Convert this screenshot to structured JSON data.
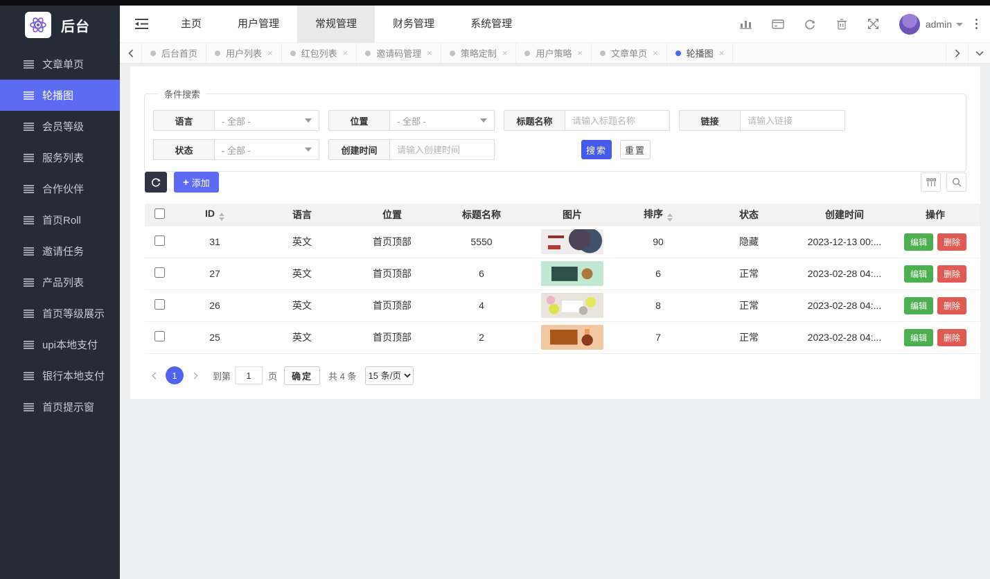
{
  "colors": {
    "sidebar_bg": "#262b38",
    "accent_indigo": "#5c6bf2",
    "search_button_blue": "#4659f0",
    "pager_circle_blue": "#5161f0",
    "active_tab_dot_blue": "#4a69f5",
    "edit_green": "#4cb050",
    "delete_red": "#e15953"
  },
  "sidebar": {
    "logo_text": "后台",
    "items": [
      {
        "label": "文章单页",
        "active": false
      },
      {
        "label": "轮播图",
        "active": true
      },
      {
        "label": "会员等级",
        "active": false
      },
      {
        "label": "服务列表",
        "active": false
      },
      {
        "label": "合作伙伴",
        "active": false
      },
      {
        "label": "首页Roll",
        "active": false
      },
      {
        "label": "邀请任务",
        "active": false
      },
      {
        "label": "产品列表",
        "active": false
      },
      {
        "label": "首页等级展示",
        "active": false
      },
      {
        "label": "upi本地支付",
        "active": false
      },
      {
        "label": "银行本地支付",
        "active": false
      },
      {
        "label": "首页提示窗",
        "active": false
      }
    ]
  },
  "topnav": {
    "items": [
      {
        "label": "主页",
        "active": false
      },
      {
        "label": "用户管理",
        "active": false
      },
      {
        "label": "常规管理",
        "active": true
      },
      {
        "label": "财务管理",
        "active": false
      },
      {
        "label": "系统管理",
        "active": false
      }
    ]
  },
  "header": {
    "user_name": "admin",
    "icons": [
      "chart-icon",
      "card-icon",
      "refresh-icon",
      "trash-icon",
      "fullscreen-icon"
    ]
  },
  "tabs": {
    "close_glyph": "×",
    "items": [
      {
        "label": "后台首页",
        "closable": false,
        "active": false
      },
      {
        "label": "用户列表",
        "closable": true,
        "active": false
      },
      {
        "label": "红包列表",
        "closable": true,
        "active": false
      },
      {
        "label": "邀请码管理",
        "closable": true,
        "active": false
      },
      {
        "label": "策略定制",
        "closable": true,
        "active": false
      },
      {
        "label": "用户策略",
        "closable": true,
        "active": false
      },
      {
        "label": "文章单页",
        "closable": true,
        "active": false
      },
      {
        "label": "轮播图",
        "closable": true,
        "active": true
      }
    ]
  },
  "search": {
    "legend": "条件搜索",
    "fields": [
      {
        "label": "语言",
        "type": "select",
        "value": "- 全部 -",
        "row": 1
      },
      {
        "label": "位置",
        "type": "select",
        "value": "- 全部 -",
        "row": 1
      },
      {
        "label": "标题名称",
        "type": "text",
        "placeholder": "请输入标题名称",
        "row": 1
      },
      {
        "label": "链接",
        "type": "text",
        "placeholder": "请输入链接",
        "row": 1
      },
      {
        "label": "状态",
        "type": "select",
        "value": "- 全部 -",
        "row": 2
      },
      {
        "label": "创建时间",
        "type": "text",
        "placeholder": "请输入创建时间",
        "row": 2
      }
    ],
    "search_label": "搜索",
    "reset_label": "重置"
  },
  "toolbar": {
    "add_plus": "+",
    "add_label": "添加"
  },
  "table": {
    "columns": [
      {
        "label": "ID",
        "sortable": true
      },
      {
        "label": "语言",
        "sortable": false
      },
      {
        "label": "位置",
        "sortable": false
      },
      {
        "label": "标题名称",
        "sortable": false
      },
      {
        "label": "图片",
        "sortable": false
      },
      {
        "label": "排序",
        "sortable": true
      },
      {
        "label": "状态",
        "sortable": false
      },
      {
        "label": "创建时间",
        "sortable": false
      },
      {
        "label": "操作",
        "sortable": false
      }
    ],
    "edit_label": "编辑",
    "delete_label": "删除",
    "rows": [
      {
        "id": "31",
        "language": "英文",
        "position": "首页顶部",
        "title": "5550",
        "thumb": "thumb-1",
        "sort": "90",
        "status": "隐藏",
        "created": "2023-12-13 00:..."
      },
      {
        "id": "27",
        "language": "英文",
        "position": "首页顶部",
        "title": "6",
        "thumb": "thumb-2",
        "sort": "6",
        "status": "正常",
        "created": "2023-02-28 04:..."
      },
      {
        "id": "26",
        "language": "英文",
        "position": "首页顶部",
        "title": "4",
        "thumb": "thumb-3",
        "sort": "8",
        "status": "正常",
        "created": "2023-02-28 04:..."
      },
      {
        "id": "25",
        "language": "英文",
        "position": "首页顶部",
        "title": "2",
        "thumb": "thumb-4",
        "sort": "7",
        "status": "正常",
        "created": "2023-02-28 04:..."
      }
    ]
  },
  "pagination": {
    "current_page": "1",
    "goto_label": "到第",
    "goto_value": "1",
    "page_label": "页",
    "confirm_label": "确定",
    "total_label": "共 4 条",
    "per_page": "15 条/页"
  }
}
